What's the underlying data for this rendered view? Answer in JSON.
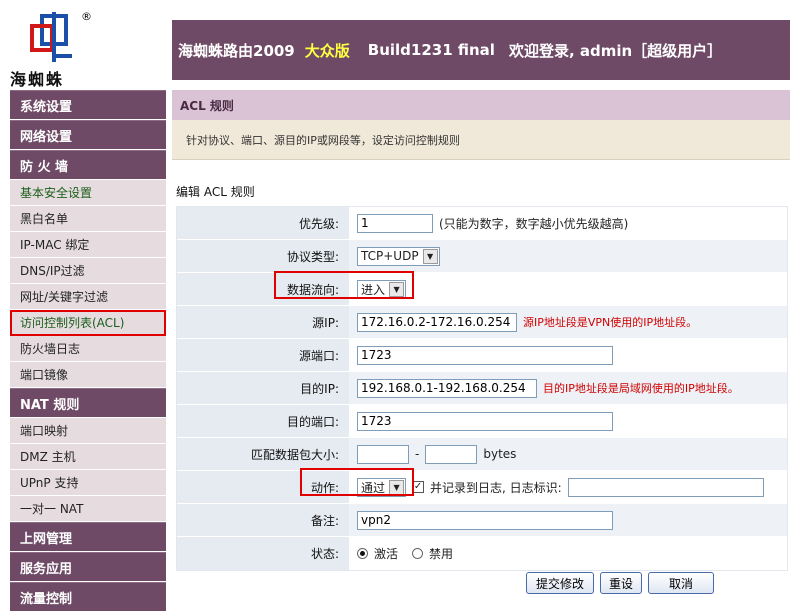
{
  "logo": {
    "text": "海蜘蛛",
    "reg": "®"
  },
  "header": {
    "product": "海蜘蛛路由2009",
    "edition": "大众版",
    "build": "Build1231 final",
    "welcome": "欢迎登录, admin［超级用户］"
  },
  "sidebar": {
    "groups": {
      "system": "系统设置",
      "network": "网络设置",
      "firewall": "防 火 墙",
      "nat": "NAT 规则",
      "internet": "上网管理",
      "service": "服务应用",
      "flow": "流量控制"
    },
    "firewall_items": [
      "基本安全设置",
      "黑白名单",
      "IP-MAC 绑定",
      "DNS/IP过滤",
      "网址/关键字过滤",
      "访问控制列表(ACL)",
      "防火墙日志",
      "端口镜像"
    ],
    "nat_items": [
      "端口映射",
      "DMZ 主机",
      "UPnP 支持",
      "一对一 NAT"
    ]
  },
  "page": {
    "title": "ACL 规则",
    "description": "针对协议、端口、源目的IP或网段等，设定访问控制规则",
    "edit_caption": "编辑 ACL 规则"
  },
  "form": {
    "priority": {
      "label": "优先级:",
      "value": "1",
      "hint": "(只能为数字，数字越小优先级越高)"
    },
    "protocol": {
      "label": "协议类型:",
      "value": "TCP+UDP"
    },
    "direction": {
      "label": "数据流向:",
      "value": "进入"
    },
    "src_ip": {
      "label": "源IP:",
      "value": "172.16.0.2-172.16.0.254",
      "note": "源IP地址段是VPN使用的IP地址段。"
    },
    "src_port": {
      "label": "源端口:",
      "value": "1723"
    },
    "dst_ip": {
      "label": "目的IP:",
      "value": "192.168.0.1-192.168.0.254",
      "note": "目的IP地址段是局域网使用的IP地址段。"
    },
    "dst_port": {
      "label": "目的端口:",
      "value": "1723"
    },
    "packet_size": {
      "label": "匹配数据包大小:",
      "min": "",
      "max": "",
      "sep": "-",
      "unit": "bytes"
    },
    "action": {
      "label": "动作:",
      "value": "通过",
      "log_label": "并记录到日志, 日志标识:",
      "log_checked": true,
      "log_tag": ""
    },
    "remark": {
      "label": "备注:",
      "value": "vpn2"
    },
    "status": {
      "label": "状态:",
      "options": [
        "激活",
        "禁用"
      ],
      "selected": "激活"
    }
  },
  "buttons": {
    "submit": "提交修改",
    "reset": "重设",
    "cancel": "取消"
  },
  "colors": {
    "header_bg": "#6e4a66",
    "highlight_red": "#e00000",
    "edition_yellow": "#ffff44"
  }
}
